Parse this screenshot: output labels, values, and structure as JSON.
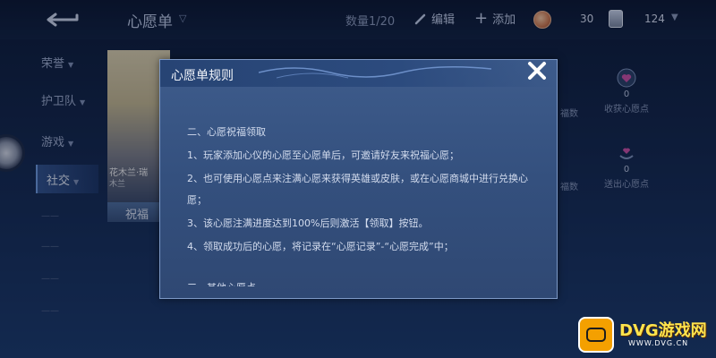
{
  "header": {
    "title": "心愿单",
    "count": "数量1/20",
    "edit_label": "编辑",
    "add_label": "添加",
    "coin_value": "30",
    "card_value": "124"
  },
  "sidebar": {
    "items": [
      {
        "label": "荣誉"
      },
      {
        "label": "护卫队"
      },
      {
        "label": "游戏"
      },
      {
        "label": "社交"
      }
    ]
  },
  "background": {
    "hero_name": "花木兰·瑞",
    "hero_sub": "木兰",
    "bless_label": "祝福"
  },
  "stats": {
    "receive_point": {
      "value": "0",
      "label": "收获心愿点"
    },
    "send_point": {
      "value": "0",
      "label": "送出心愿点"
    },
    "left_label_1": "福数",
    "left_label_2": "福数"
  },
  "modal": {
    "title": "心愿单规则",
    "section_title": "二、心愿祝福领取",
    "lines": [
      "1、玩家添加心仪的心愿至心愿单后，可邀请好友来祝福心愿；",
      "2、也可使用心愿点来注满心愿来获得英雄或皮肤，或在心愿商城中进行兑换心",
      "愿；",
      "3、该心愿注满进度达到100%后则激活【领取】按钮。",
      "4、领取成功后的心愿，将记录在“心愿记录”-“心愿完成”中；"
    ],
    "next_section_partial": "三、其他心愿点"
  },
  "watermark": {
    "text": "DVG游戏网",
    "url": "WWW.DVG.CN"
  },
  "colors": {
    "modal_bg": "#34507e",
    "modal_border": "#7d99c6",
    "watermark_gold": "#f4a000"
  }
}
